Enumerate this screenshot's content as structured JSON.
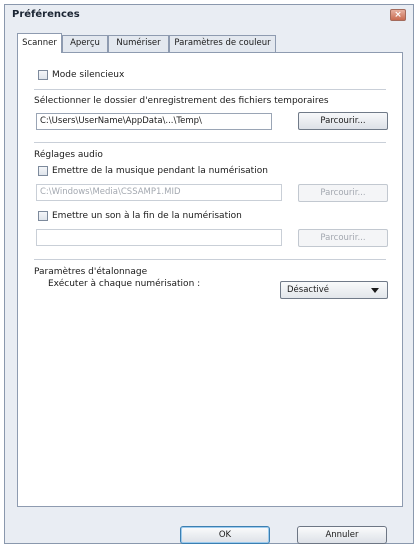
{
  "window": {
    "title": "Préférences",
    "close_label": "×"
  },
  "tabs": [
    {
      "label": "Scanner"
    },
    {
      "label": "Aperçu"
    },
    {
      "label": "Numériser"
    },
    {
      "label": "Paramètres de couleur"
    }
  ],
  "scanner": {
    "silent_mode_label": "Mode silencieux",
    "temp_folder": {
      "label": "Sélectionner le dossier d'enregistrement des fichiers temporaires",
      "path": "C:\\Users\\UserName\\AppData\\...\\Temp\\",
      "browse_label": "Parcourir..."
    },
    "audio": {
      "heading": "Réglages audio",
      "music_label": "Emettre de la musique pendant la numérisation",
      "music_path": "C:\\Windows\\Media\\CSSAMP1.MID",
      "music_browse_label": "Parcourir...",
      "end_sound_label": "Emettre un son à la fin de la numérisation",
      "end_sound_path": "",
      "end_sound_browse_label": "Parcourir..."
    },
    "calibration": {
      "heading": "Paramètres d'étalonnage",
      "run_label": "Exécuter à chaque numérisation :",
      "selected": "Désactivé"
    }
  },
  "footer": {
    "ok_label": "OK",
    "cancel_label": "Annuler"
  }
}
